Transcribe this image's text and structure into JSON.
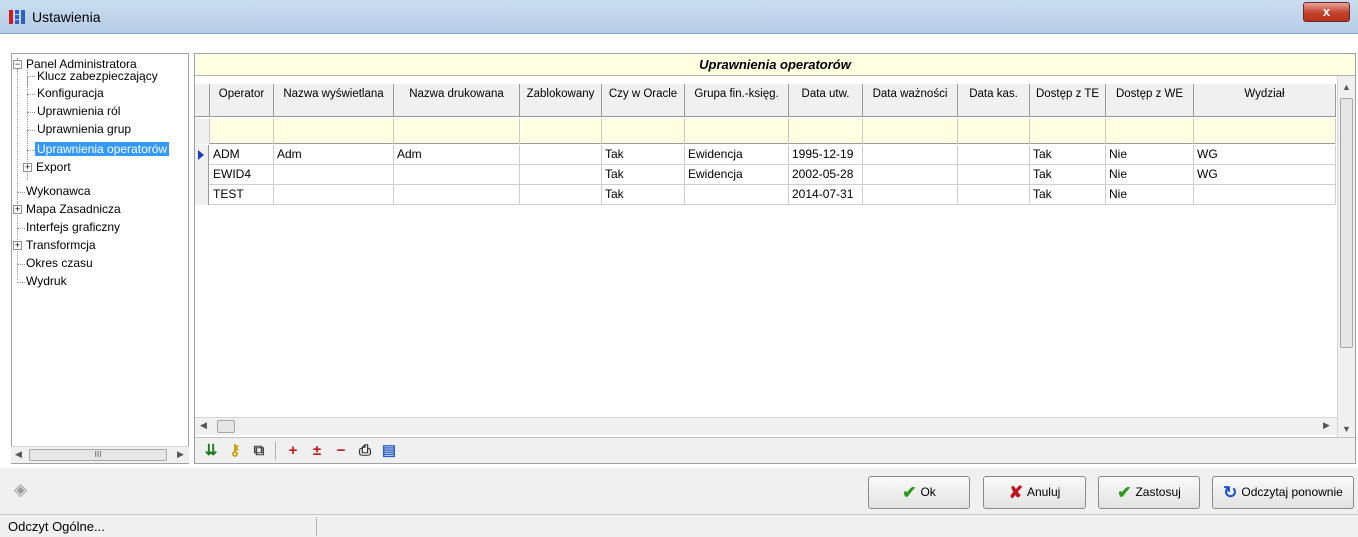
{
  "window": {
    "title": "Ustawienia",
    "close_label": "x"
  },
  "tree": {
    "items": [
      {
        "label": "Panel Administratora",
        "expander": "−"
      },
      {
        "label": "Klucz zabezpieczający"
      },
      {
        "label": "Konfiguracja"
      },
      {
        "label": "Uprawnienia ról"
      },
      {
        "label": "Uprawnienia grup"
      },
      {
        "label": "Uprawnienia operatorów",
        "selected": true
      },
      {
        "label": "Export",
        "expander": "+"
      },
      {
        "label": "Wykonawca"
      },
      {
        "label": "Mapa Zasadnicza",
        "expander": "+"
      },
      {
        "label": "Interfejs graficzny"
      },
      {
        "label": "Transformcja",
        "expander": "+"
      },
      {
        "label": "Okres czasu"
      },
      {
        "label": "Wydruk"
      }
    ],
    "scroll_thumb_label": "III"
  },
  "grid": {
    "title": "Uprawnienia operatorów",
    "columns": [
      "Operator",
      "Nazwa wyświetlana",
      "Nazwa drukowana",
      "Zablokowany",
      "Czy w Oracle",
      "Grupa fin.-księg.",
      "Data utw.",
      "Data ważności",
      "Data kas.",
      "Dostęp z TE",
      "Dostęp z WE",
      "Wydział"
    ],
    "rows": [
      [
        "ADM",
        "Adm",
        "Adm",
        "",
        "Tak",
        "Ewidencja",
        "1995-12-19",
        "",
        "",
        "Tak",
        "Nie",
        "WG"
      ],
      [
        "EWID4",
        "",
        "",
        "",
        "Tak",
        "Ewidencja",
        "2002-05-28",
        "",
        "",
        "Tak",
        "Nie",
        "WG"
      ],
      [
        "TEST",
        "",
        "",
        "",
        "Tak",
        "",
        "2014-07-31",
        "",
        "",
        "Tak",
        "Nie",
        ""
      ]
    ],
    "current_row": 0
  },
  "toolbar": {
    "icons": [
      "import-icon",
      "key-icon",
      "copy-icon",
      "add-icon",
      "add-remove-icon",
      "remove-icon",
      "print-icon",
      "report-icon"
    ]
  },
  "buttons": {
    "ok": "Ok",
    "cancel": "Anuluj",
    "apply": "Zastosuj",
    "reload": "Odczytaj ponownie"
  },
  "status": {
    "text": "Odczyt Ogólne..."
  },
  "colors": {
    "accent": "#3399ff",
    "filter_bg": "#ffffe1",
    "ok_green": "#2e9a1c",
    "cancel_red": "#c3141e",
    "reload_blue": "#1b50c8"
  }
}
